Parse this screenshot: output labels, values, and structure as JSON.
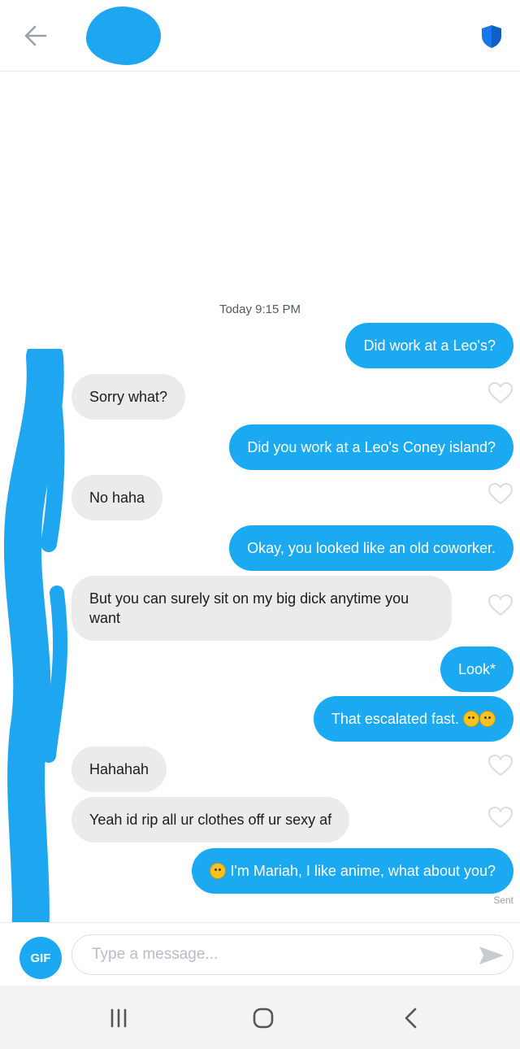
{
  "header": {
    "back_icon": "arrow-left-icon",
    "shield_icon": "shield-icon",
    "shield_color": "#1ba9f2"
  },
  "conversation": {
    "timestamp": "Today 9:15 PM",
    "messages": [
      {
        "side": "out",
        "text": "Did work at a Leo's?"
      },
      {
        "side": "in",
        "text": "Sorry what?"
      },
      {
        "side": "out",
        "text": "Did you work at a Leo's Coney island?"
      },
      {
        "side": "in",
        "text": "No haha"
      },
      {
        "side": "out",
        "text": "Okay, you looked like an old coworker."
      },
      {
        "side": "in",
        "text": "But you can surely sit on my big dick anytime you want"
      },
      {
        "side": "out",
        "text": "Look*"
      },
      {
        "side": "out",
        "text": "That escalated fast."
      },
      {
        "side": "in",
        "text": "Hahahah"
      },
      {
        "side": "in",
        "text": "Yeah id rip all ur clothes off ur sexy af"
      },
      {
        "side": "out",
        "text": "I'm Mariah, I like anime, what about you?"
      }
    ],
    "status": "Sent"
  },
  "composer": {
    "gif_label": "GIF",
    "placeholder": "Type a message...",
    "send_icon": "send-icon"
  },
  "navbar": {
    "recent_icon": "recent-apps-icon",
    "home_icon": "home-icon",
    "back_icon": "chevron-left-icon"
  },
  "colors": {
    "outgoing_bubble": "#1ba9f2",
    "incoming_bubble": "#ebebeb",
    "redaction": "#1fa6f0"
  }
}
